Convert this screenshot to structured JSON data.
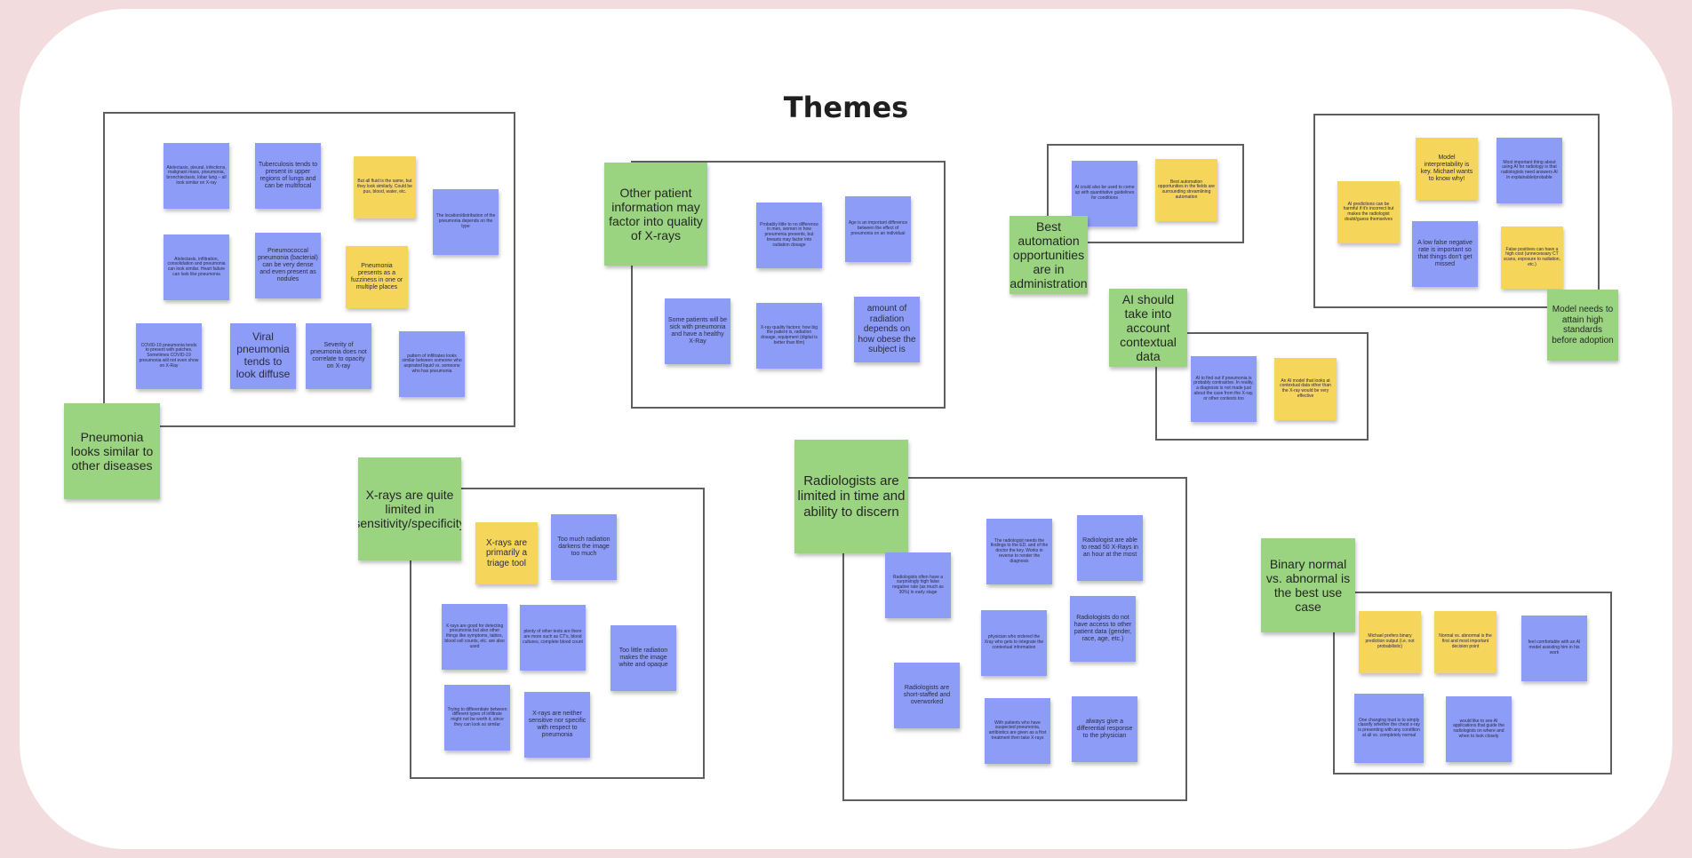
{
  "title": "Themes",
  "themes": {
    "pneumonia_similar": "Pneumonia looks similar to other diseases",
    "other_patient_info": "Other patient information may factor into quality of X-rays",
    "best_automation": "Best automation opportunities are in administration",
    "ai_contextual": "AI should take into account contextual data",
    "model_standards": "Model needs to attain high standards before adoption",
    "xrays_limited": "X-rays are quite limited in sensitivity/specificity",
    "radiologists_limited": "Radiologists are limited in time and ability to discern",
    "binary_normal": "Binary normal vs. abnormal is the best use case"
  },
  "g1": {
    "n1": "Atelectasis, pleural, infections, malignant mass, pneumonia, bronchiectasis, lobar lung – all look similar on X-ray",
    "n2": "Tuberculosis tends to present in upper regions of lungs and can be multifocal",
    "n3": "But all fluid is the same, but they look similarly. Could be pus, blood, water, etc.",
    "n4": "The location/distribution of the pneumonia depends on the type",
    "n5": "Atelectasis, infiltration, consolidation and pneumonia can look similar. Heart failure can look like pneumonia",
    "n6": "Pneumococcal pneumonia (bacterial) can be very dense and even present as nodules",
    "n7": "Pneumonia presents as a fuzziness in one or multiple places",
    "n8": "COVID-19 pneumonia tends to present with patches. Sometimes COVID-19 pneumonia will not even show on X-Ray",
    "n9": "Viral pneumonia tends to look diffuse",
    "n10": "Severity of pneumonia does not correlate to opacity on X-ray",
    "n11": "pattern of infiltrates looks similar between someone who aspirated liquid vs. someone who has pneumonia"
  },
  "g2": {
    "n1": "Probably little to no difference in men, women in how pneumonia presents, but breasts may factor into radiation dosage",
    "n2": "Age is an important difference between the effect of pneumonia on an individual",
    "n3": "Some patients will be sick with pneumonia and have a healthy X-Ray",
    "n4": "X-ray quality factors: how big the patient is, radiation dosage, equipment (digital is better than film)",
    "n5": "amount of radiation depends on how obese the subject is"
  },
  "g3": {
    "n1": "AI could also be used to come up with quantitative guidelines for conditions",
    "n2": "Best automation opportunities in the fields are surrounding streamlining automation"
  },
  "g4": {
    "n1": "AI to find out if pneumonia is probably contrastive. In reality, a diagnosis is not made just about the case from the X-ray, or other contexts too",
    "n2": "An AI model that looks at contextual data other than the X-ray would be very effective"
  },
  "g5": {
    "n1": "Model interpretability is key. Michael wants to know why!",
    "n2": "Most important thing about using AI for radiology is that radiologists need answers AI in explainable/probable",
    "n3": "AI predictions can be harmful if it's incorrect but makes the radiologist doubt/guess themselves",
    "n4": "A low false negative rate is important so that things don't get missed",
    "n5": "False positives can have a high cost (unnecessary CT scans, exposure to radiation, etc.)"
  },
  "g6": {
    "n1": "X-rays are primarily a triage tool",
    "n2": "Too much radiation darkens the image too much",
    "n3": "X-rays are good for detecting pneumonia but also other things like symptoms, tables, blood cell counts, etc. are also used",
    "n4": "plenty of other tests are there are more such as CT's, blood cultures, complete blood count",
    "n5": "Too little radiation makes the image white and opaque",
    "n6": "Trying to differentiate between different types of infiltrate might not be worth it, since they can look so similar",
    "n7": "X-rays are neither sensitive nor specific with respect to pneumonia"
  },
  "g7": {
    "n1": "The radiologist needs the findings to the ED. and of the doctor the key. Works in reverse to render the diagnosis",
    "n2": "Radiologist are able to read 50 X-Rays in an hour at the most",
    "n3": "Radiologists often have a surprisingly high false negative rate (as much as 30%) in early stage",
    "n4": "physician who ordered the Xray who gets to integrate the contextual information",
    "n5": "Radiologists do not have access to other patient data (gender, race, age, etc.)",
    "n6": "Radiologists are short-staffed and overworked",
    "n7": "With patients who have suspected pneumonia, antibiotics are given as a first treatment then take X-rays",
    "n8": "always give a differential response to the physician"
  },
  "g8": {
    "n1": "Michael prefers binary prediction output (i.e. not probabilistic)",
    "n2": "Normal vs. abnormal is the first and most important decision point",
    "n3": "feel comfortable with an AI model assisting him in his work",
    "n4": "One changing trust is to simply classify whether the chest x-ray is presenting with any condition at all vs. completely normal",
    "n5": "would like to see AI applications that guide the radiologists on where and when to look closely"
  },
  "colors": {
    "blue": "#8d9cf6",
    "yellow": "#f6d55b",
    "green": "#9ad481",
    "background": "#f3dcdd"
  }
}
